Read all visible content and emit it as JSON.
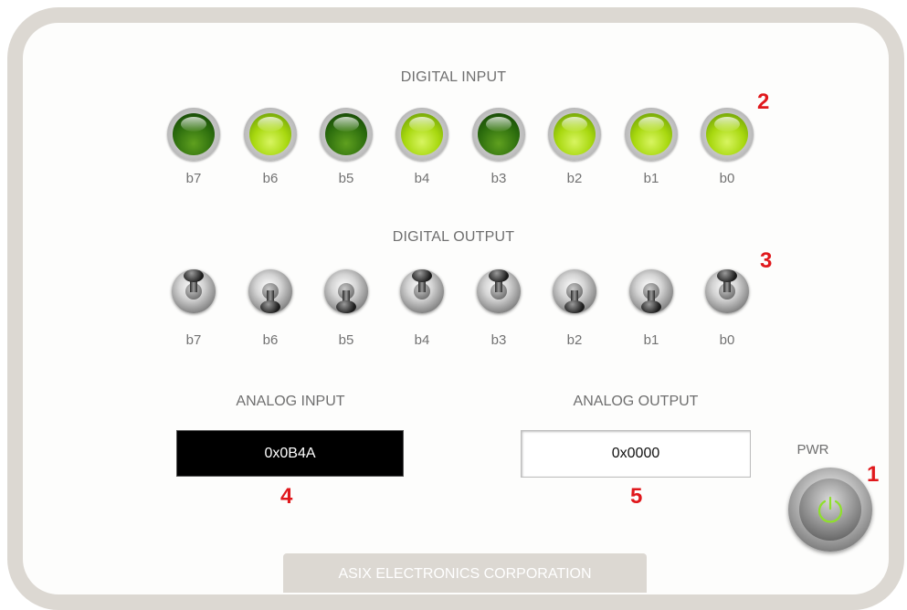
{
  "digital_input": {
    "title": "DIGITAL INPUT",
    "marker": "2",
    "bits": [
      {
        "label": "b7",
        "state": "off"
      },
      {
        "label": "b6",
        "state": "on"
      },
      {
        "label": "b5",
        "state": "off"
      },
      {
        "label": "b4",
        "state": "on"
      },
      {
        "label": "b3",
        "state": "off"
      },
      {
        "label": "b2",
        "state": "on"
      },
      {
        "label": "b1",
        "state": "on"
      },
      {
        "label": "b0",
        "state": "on"
      }
    ]
  },
  "digital_output": {
    "title": "DIGITAL OUTPUT",
    "marker": "3",
    "bits": [
      {
        "label": "b7",
        "state": "up"
      },
      {
        "label": "b6",
        "state": "down"
      },
      {
        "label": "b5",
        "state": "down"
      },
      {
        "label": "b4",
        "state": "up"
      },
      {
        "label": "b3",
        "state": "up"
      },
      {
        "label": "b2",
        "state": "down"
      },
      {
        "label": "b1",
        "state": "down"
      },
      {
        "label": "b0",
        "state": "up"
      }
    ]
  },
  "analog_input": {
    "title": "ANALOG INPUT",
    "value": "0x0B4A",
    "marker": "4"
  },
  "analog_output": {
    "title": "ANALOG OUTPUT",
    "value": "0x0000",
    "marker": "5"
  },
  "power": {
    "label": "PWR",
    "marker": "1",
    "icon": "power-icon"
  },
  "footer": {
    "text": "ASIX ELECTRONICS CORPORATION"
  },
  "colors": {
    "led_on": "#a8d80f",
    "led_off": "#2b6c0d",
    "marker": "#e0181c",
    "frame": "#dcd8d2"
  }
}
